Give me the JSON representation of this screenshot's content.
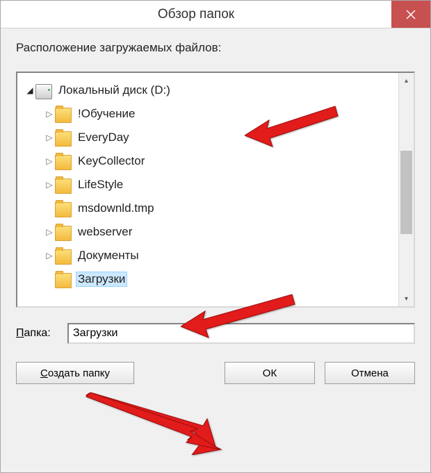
{
  "titlebar": {
    "title": "Обзор папок"
  },
  "prompt": "Расположение загружаемых файлов:",
  "tree": {
    "root": {
      "label": "Локальный диск (D:)",
      "icon": "drive",
      "expanded": true
    },
    "children": [
      {
        "label": "!Обучение",
        "icon": "folder",
        "expandable": true
      },
      {
        "label": "EveryDay",
        "icon": "folder",
        "expandable": true
      },
      {
        "label": "KeyCollector",
        "icon": "folder",
        "expandable": true
      },
      {
        "label": "LifeStyle",
        "icon": "folder",
        "expandable": true
      },
      {
        "label": "msdownld.tmp",
        "icon": "folder",
        "expandable": false
      },
      {
        "label": "webserver",
        "icon": "folder",
        "expandable": true
      },
      {
        "label": "Документы",
        "icon": "folder",
        "expandable": true
      },
      {
        "label": "Загрузки",
        "icon": "folder",
        "expandable": false,
        "selected": true
      }
    ]
  },
  "folder_field": {
    "label_pre": "П",
    "label_rest": "апка:",
    "value": "Загрузки"
  },
  "buttons": {
    "new_folder_pre": "С",
    "new_folder_rest": "оздать папку",
    "ok": "ОК",
    "cancel": "Отмена"
  }
}
